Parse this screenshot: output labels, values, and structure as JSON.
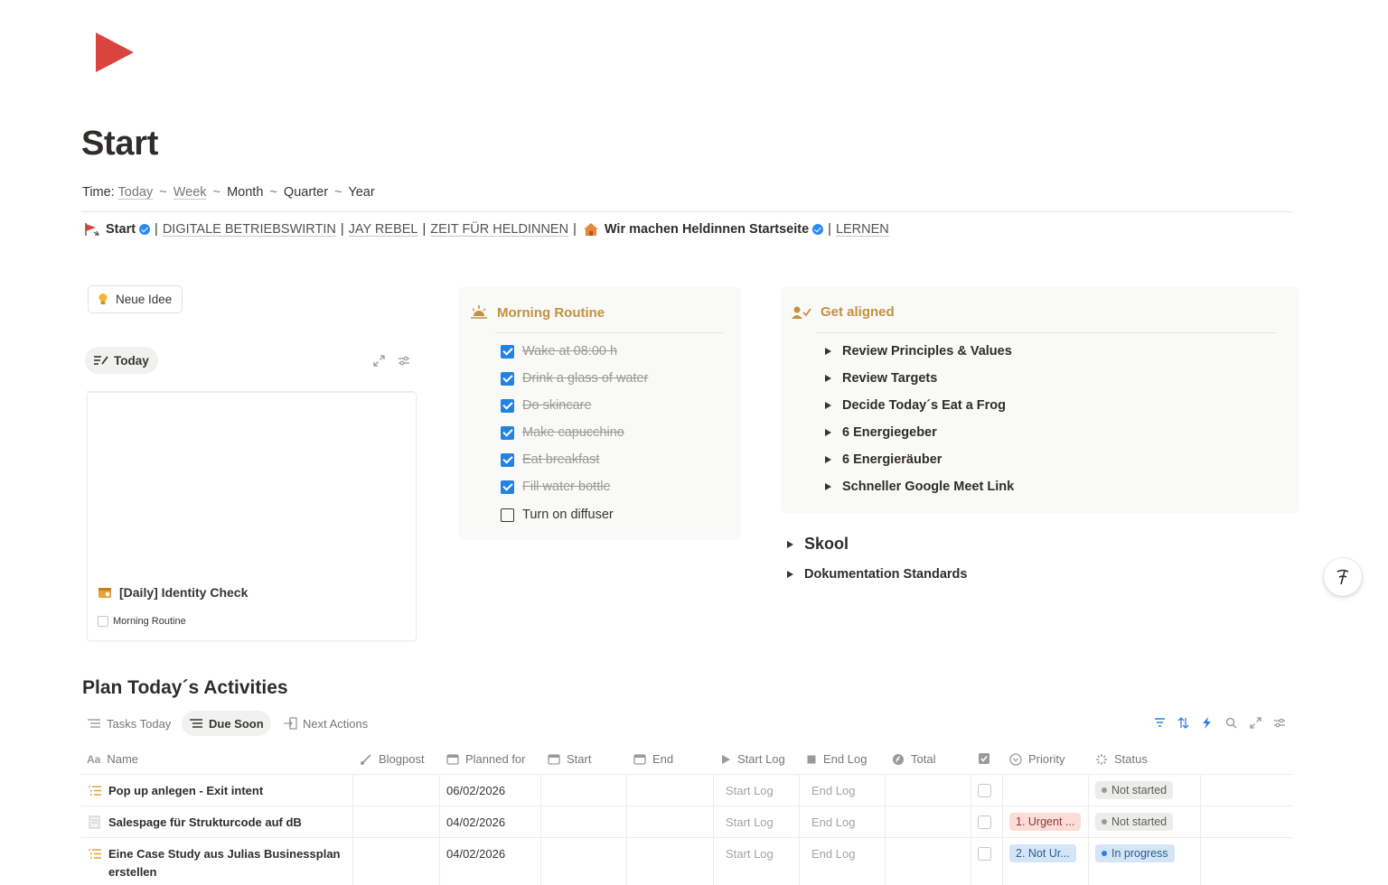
{
  "page": {
    "title": "Start",
    "logo_icon": "red-play-triangle-icon"
  },
  "time_row": {
    "label": "Time:",
    "today": "Today",
    "week": "Week",
    "month": "Month",
    "quarter": "Quarter",
    "year": "Year",
    "separator": "~"
  },
  "nav": {
    "start": "Start",
    "digitale": "DIGITALE BETRIEBSWIRTIN",
    "jay": "JAY REBEL",
    "zeit": "ZEIT FÜR HELDINNEN",
    "heldinnen": "Wir machen Heldinnen Startseite",
    "lernen": "LERNEN",
    "bar": "|"
  },
  "left": {
    "neue_idee": "Neue Idee",
    "today_tab": "Today",
    "card_title": "[Daily] Identity Check",
    "card_sub": "Morning Routine"
  },
  "morning": {
    "title": "Morning Routine",
    "items": [
      {
        "label": "Wake at 08:00 h",
        "done": true
      },
      {
        "label": "Drink a glass of water",
        "done": true
      },
      {
        "label": "Do skincare",
        "done": true
      },
      {
        "label": "Make capucchino",
        "done": true
      },
      {
        "label": "Eat breakfast",
        "done": true
      },
      {
        "label": "Fill water bottle",
        "done": true
      },
      {
        "label": "Turn on diffuser",
        "done": false
      }
    ]
  },
  "aligned": {
    "title": "Get aligned",
    "items": [
      "Review Principles & Values",
      "Review Targets",
      "Decide Today´s Eat a Frog",
      "6 Energiegeber",
      "6 Energieräuber",
      "Schneller Google Meet Link"
    ]
  },
  "toggles": {
    "skool": "Skool",
    "doku": "Dokumentation Standards"
  },
  "plan": {
    "title": "Plan Today´s Activities",
    "tabs": [
      "Tasks Today",
      "Due Soon",
      "Next Actions"
    ],
    "active_tab": "Due Soon",
    "columns": {
      "name": "Name",
      "blogpost": "Blogpost",
      "planned": "Planned for",
      "start": "Start",
      "end": "End",
      "start_log": "Start Log",
      "end_log": "End Log",
      "total": "Total",
      "priority": "Priority",
      "status": "Status"
    },
    "rows": [
      {
        "name": "Pop up anlegen - Exit intent",
        "planned": "06/02/2026",
        "start_log": "Start Log",
        "end_log": "End Log",
        "priority": "",
        "status": "Not started"
      },
      {
        "name": "Salespage für Strukturcode auf dB",
        "planned": "04/02/2026",
        "start_log": "Start Log",
        "end_log": "End Log",
        "priority": "1. Urgent ...",
        "status": "Not started"
      },
      {
        "name": "Eine Case Study aus Julias Businessplan",
        "name2": "erstellen",
        "planned": "04/02/2026",
        "start_log": "Start Log",
        "end_log": "End Log",
        "priority": "2. Not Ur...",
        "status": "In progress"
      }
    ]
  },
  "colors": {
    "accent_gold": "#c29240",
    "checkbox_blue": "#2383e2",
    "logo_red": "#d9443f",
    "urgent_bg": "#fbdcd7",
    "not_urgent_bg": "#d3e5f7",
    "in_progress_dot": "#2383e2"
  }
}
